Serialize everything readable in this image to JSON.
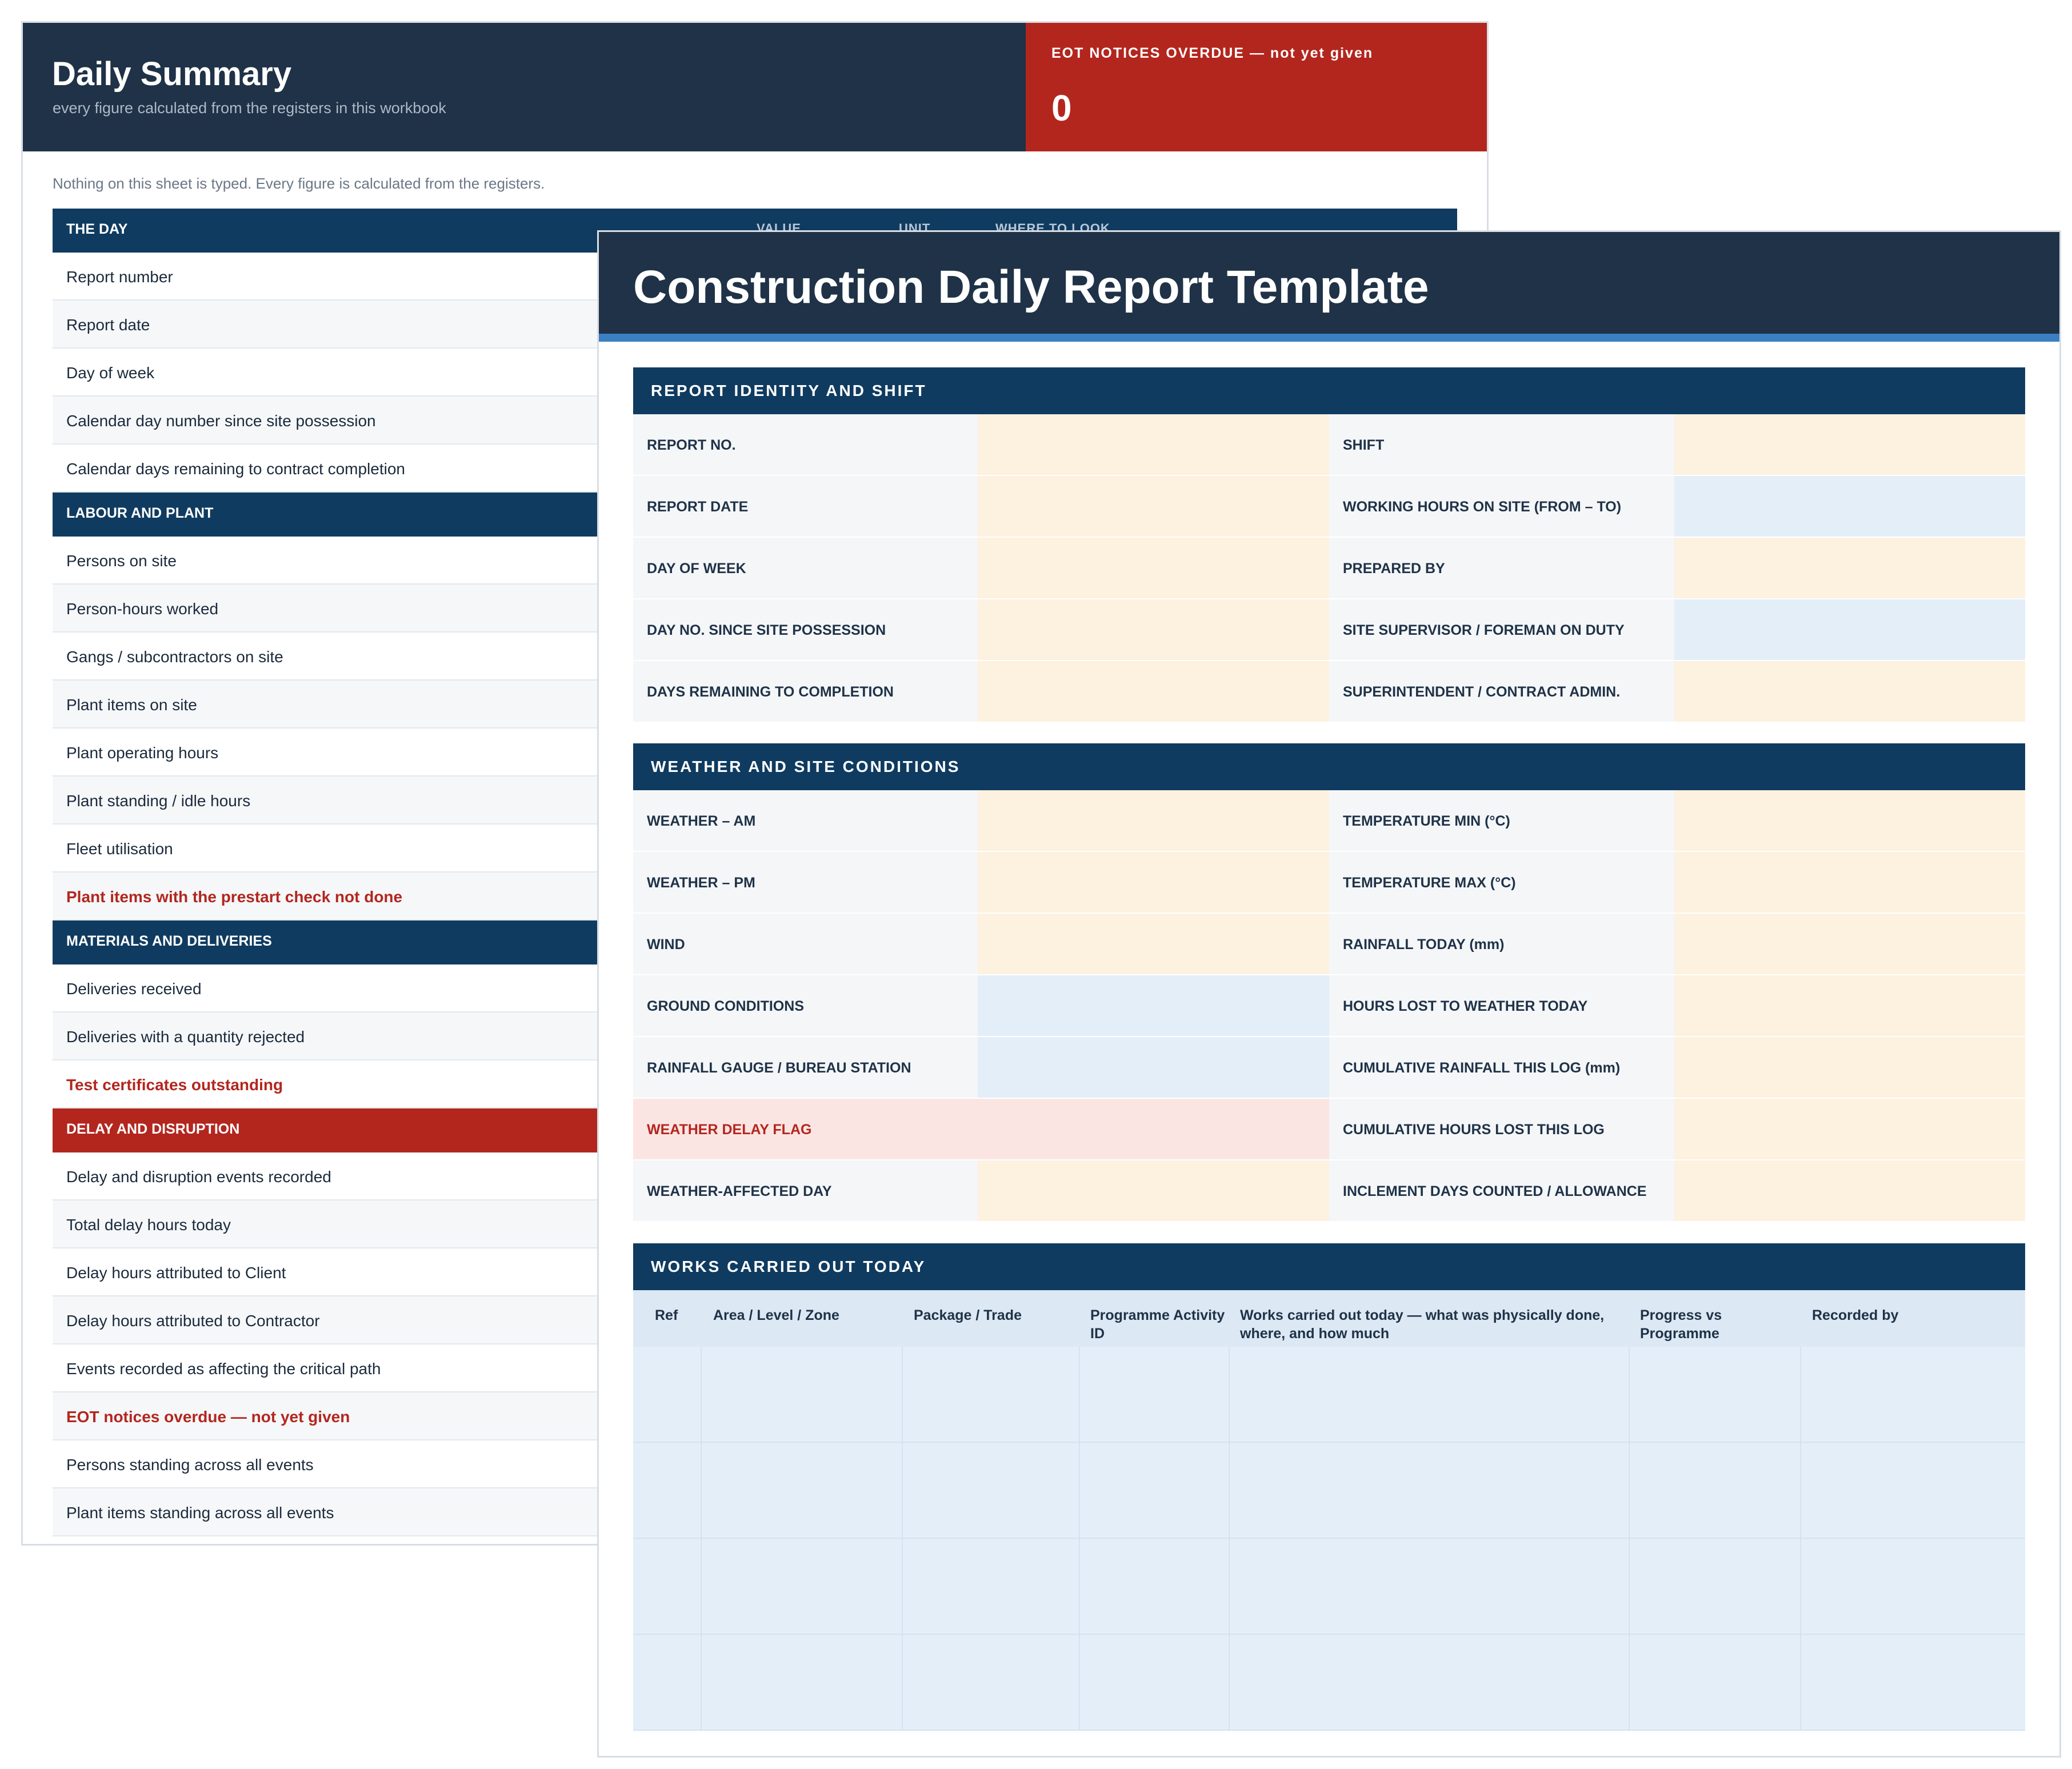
{
  "summary": {
    "title": "Daily Summary",
    "subtitle": "every figure calculated from the registers in this workbook",
    "kpi": {
      "label": "EOT NOTICES OVERDUE — not yet given",
      "value": "0"
    },
    "note": "Nothing on this sheet is typed. Every figure is calculated from the registers.",
    "columns": [
      "VALUE",
      "UNIT",
      "WHERE TO LOOK"
    ],
    "sections": [
      {
        "title": "THE DAY",
        "rows": [
          {
            "label": "Report number",
            "alert": false
          },
          {
            "label": "Report date",
            "alert": false
          },
          {
            "label": "Day of week",
            "alert": false
          },
          {
            "label": "Calendar day number since site possession",
            "alert": false
          },
          {
            "label": "Calendar days remaining to contract completion",
            "alert": false
          }
        ]
      },
      {
        "title": "LABOUR AND PLANT",
        "rows": [
          {
            "label": "Persons on site",
            "alert": false
          },
          {
            "label": "Person-hours worked",
            "alert": false
          },
          {
            "label": "Gangs / subcontractors on site",
            "alert": false
          },
          {
            "label": "Plant items on site",
            "alert": false
          },
          {
            "label": "Plant operating hours",
            "alert": false
          },
          {
            "label": "Plant standing / idle hours",
            "alert": false
          },
          {
            "label": "Fleet utilisation",
            "alert": false
          },
          {
            "label": "Plant items with the prestart check not done",
            "alert": true
          }
        ]
      },
      {
        "title": "MATERIALS AND DELIVERIES",
        "rows": [
          {
            "label": "Deliveries received",
            "alert": false
          },
          {
            "label": "Deliveries with a quantity rejected",
            "alert": false
          },
          {
            "label": "Test certificates outstanding",
            "alert": true
          }
        ]
      },
      {
        "title": "DELAY AND DISRUPTION",
        "red": true,
        "rows": [
          {
            "label": "Delay and disruption events recorded",
            "alert": false
          },
          {
            "label": "Total delay hours today",
            "alert": false
          },
          {
            "label": "Delay hours attributed to Client",
            "alert": false
          },
          {
            "label": "Delay hours attributed to Contractor",
            "alert": false
          },
          {
            "label": "Events recorded as affecting the critical path",
            "alert": false
          },
          {
            "label": "EOT notices overdue — not yet given",
            "alert": true
          },
          {
            "label": "Persons standing across all events",
            "alert": false
          },
          {
            "label": "Plant items standing across all events",
            "alert": false
          }
        ]
      }
    ]
  },
  "report": {
    "title": "Construction Daily Report Template",
    "identity": {
      "title": "REPORT IDENTITY AND SHIFT",
      "rows": [
        {
          "left": "REPORT NO.",
          "left_kind": "auto",
          "right": "SHIFT",
          "right_kind": "auto"
        },
        {
          "left": "REPORT DATE",
          "left_kind": "auto",
          "right": "WORKING HOURS ON SITE (FROM – TO)",
          "right_kind": "select"
        },
        {
          "left": "DAY OF WEEK",
          "left_kind": "auto",
          "right": "PREPARED BY",
          "right_kind": "auto"
        },
        {
          "left": "DAY NO. SINCE SITE POSSESSION",
          "left_kind": "auto",
          "right": "SITE SUPERVISOR / FOREMAN ON DUTY",
          "right_kind": "select"
        },
        {
          "left": "DAYS REMAINING TO COMPLETION",
          "left_kind": "auto",
          "right": "SUPERINTENDENT / CONTRACT ADMIN.",
          "right_kind": "auto"
        }
      ]
    },
    "weather": {
      "title": "WEATHER AND SITE CONDITIONS",
      "rows": [
        {
          "left": "WEATHER – AM",
          "left_kind": "auto",
          "right": "TEMPERATURE MIN (°C)",
          "right_kind": "auto"
        },
        {
          "left": "WEATHER – PM",
          "left_kind": "auto",
          "right": "TEMPERATURE MAX (°C)",
          "right_kind": "auto"
        },
        {
          "left": "WIND",
          "left_kind": "auto",
          "right": "RAINFALL TODAY (mm)",
          "right_kind": "auto"
        },
        {
          "left": "GROUND CONDITIONS",
          "left_kind": "select",
          "right": "HOURS LOST TO WEATHER TODAY",
          "right_kind": "auto"
        },
        {
          "left": "RAINFALL GAUGE / BUREAU STATION",
          "left_kind": "select",
          "right": "CUMULATIVE RAINFALL THIS LOG (mm)",
          "right_kind": "auto"
        },
        {
          "left": "WEATHER DELAY FLAG",
          "left_kind": "flag",
          "right": "CUMULATIVE HOURS LOST THIS LOG",
          "right_kind": "auto"
        },
        {
          "left": "WEATHER-AFFECTED DAY",
          "left_kind": "auto",
          "right": "INCLEMENT DAYS COUNTED / ALLOWANCE",
          "right_kind": "auto"
        }
      ]
    },
    "works": {
      "title": "WORKS CARRIED OUT TODAY",
      "columns": [
        "Ref",
        "Area / Level / Zone",
        "Package / Trade",
        "Programme Activity ID",
        "Works carried out today — what was physically done, where, and how much",
        "Progress vs Programme",
        "Recorded by"
      ],
      "empty_rows": 4
    }
  },
  "colors": {
    "navy": "#1f3247",
    "section_blue": "#0f3b60",
    "accent_blue": "#3a7fc1",
    "alert_red": "#b3261e",
    "auto_fill": "#fdf1df",
    "select_fill": "#e3eef8",
    "flag_fill": "#fbe5e3"
  }
}
